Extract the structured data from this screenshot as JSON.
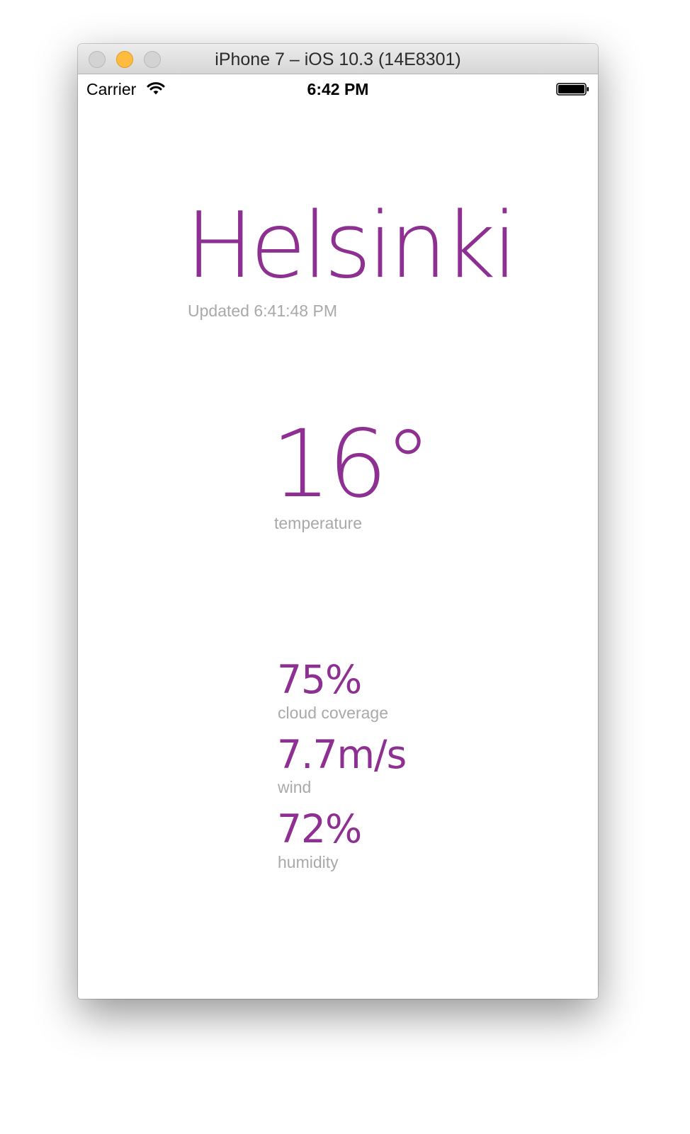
{
  "window": {
    "title": "iPhone 7 – iOS 10.3 (14E8301)"
  },
  "status_bar": {
    "carrier": "Carrier",
    "time": "6:42 PM",
    "wifi_icon": "wifi-icon",
    "battery_icon": "battery-full-icon"
  },
  "weather": {
    "city": "Helsinki",
    "updated": "Updated 6:41:48 PM",
    "temperature": {
      "value": "16°",
      "label": "temperature"
    },
    "stats": [
      {
        "value": "75%",
        "label": "cloud coverage"
      },
      {
        "value": "7.7m/s",
        "label": "wind"
      },
      {
        "value": "72%",
        "label": "humidity"
      }
    ]
  },
  "colors": {
    "accent": "#8e3091",
    "muted_text": "#a9a9a9",
    "minimize_button": "#fdbc40"
  }
}
